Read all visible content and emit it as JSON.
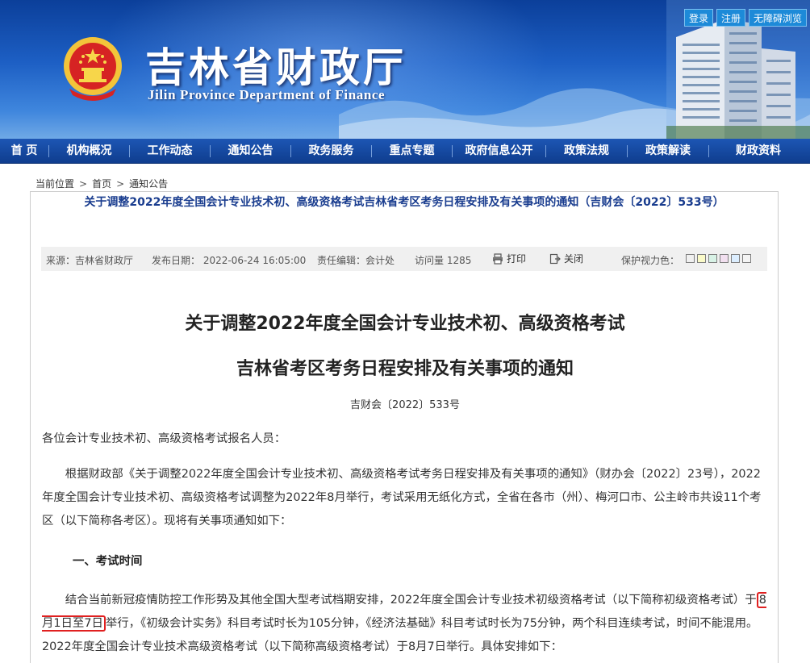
{
  "header": {
    "title_cn": "吉林省财政厅",
    "title_en": "Jilin Province Department of Finance",
    "links": [
      "登录",
      "注册",
      "无障碍浏览"
    ]
  },
  "nav": {
    "items": [
      "首 页",
      "机构概况",
      "工作动态",
      "通知公告",
      "政务服务",
      "重点专题",
      "政府信息公开",
      "政策法规",
      "政策解读",
      "财政资料"
    ]
  },
  "breadcrumb": {
    "label": "当前位置",
    "items": [
      "首页",
      "通知公告"
    ],
    "separator": ">"
  },
  "article": {
    "head_title": "关于调整2022年度全国会计专业技术初、高级资格考试吉林省考区考务日程安排及有关事项的通知（吉财会〔2022〕533号）",
    "meta": {
      "source": "来源：吉林省财政厅",
      "date": "发布日期： 2022-06-24 16:05:00",
      "editor": "责任编辑：会计处",
      "views": "访问量 1285",
      "print": "打印",
      "close": "关闭",
      "eye_care": "保护视力色："
    },
    "eye_care_colors": [
      "#f0f0f0",
      "#fafac8",
      "#d8f2e6",
      "#f2e0f0",
      "#dceeff",
      "#f4f4f4"
    ],
    "title_line1": "关于调整2022年度全国会计专业技术初、高级资格考试",
    "title_line2": "吉林省考区考务日程安排及有关事项的通知",
    "doc_no": "吉财会〔2022〕533号",
    "salutation": "各位会计专业技术初、高级资格考试报名人员：",
    "para1": "根据财政部《关于调整2022年度全国会计专业技术初、高级资格考试考务日程安排及有关事项的通知》（财办会〔2022〕23号），2022年度全国会计专业技术初、高级资格考试调整为2022年8月举行，考试采用无纸化方式，全省在各市（州）、梅河口市、公主岭市共设11个考区（以下简称各考区）。现将有关事项通知如下：",
    "section1": "一、考试时间",
    "para2_before": "结合当前新冠疫情防控工作形势及其他全国大型考试档期安排，2022年度全国会计专业技术初级资格考试（以下简称初级资格考试）于",
    "para2_highlight": "8月1日至7日",
    "para2_after": "举行，《初级会计实务》科目考试时长为105分钟，《经济法基础》科目考试时长为75分钟，两个科目连续考试，时间不能混用。2022年度全国会计专业技术高级资格考试（以下简称高级资格考试）于8月7日举行。具体安排如下："
  },
  "colors": {
    "nav_bg": "#123f8f",
    "head_title": "#1a3d8f",
    "highlight_border": "#e02020"
  }
}
